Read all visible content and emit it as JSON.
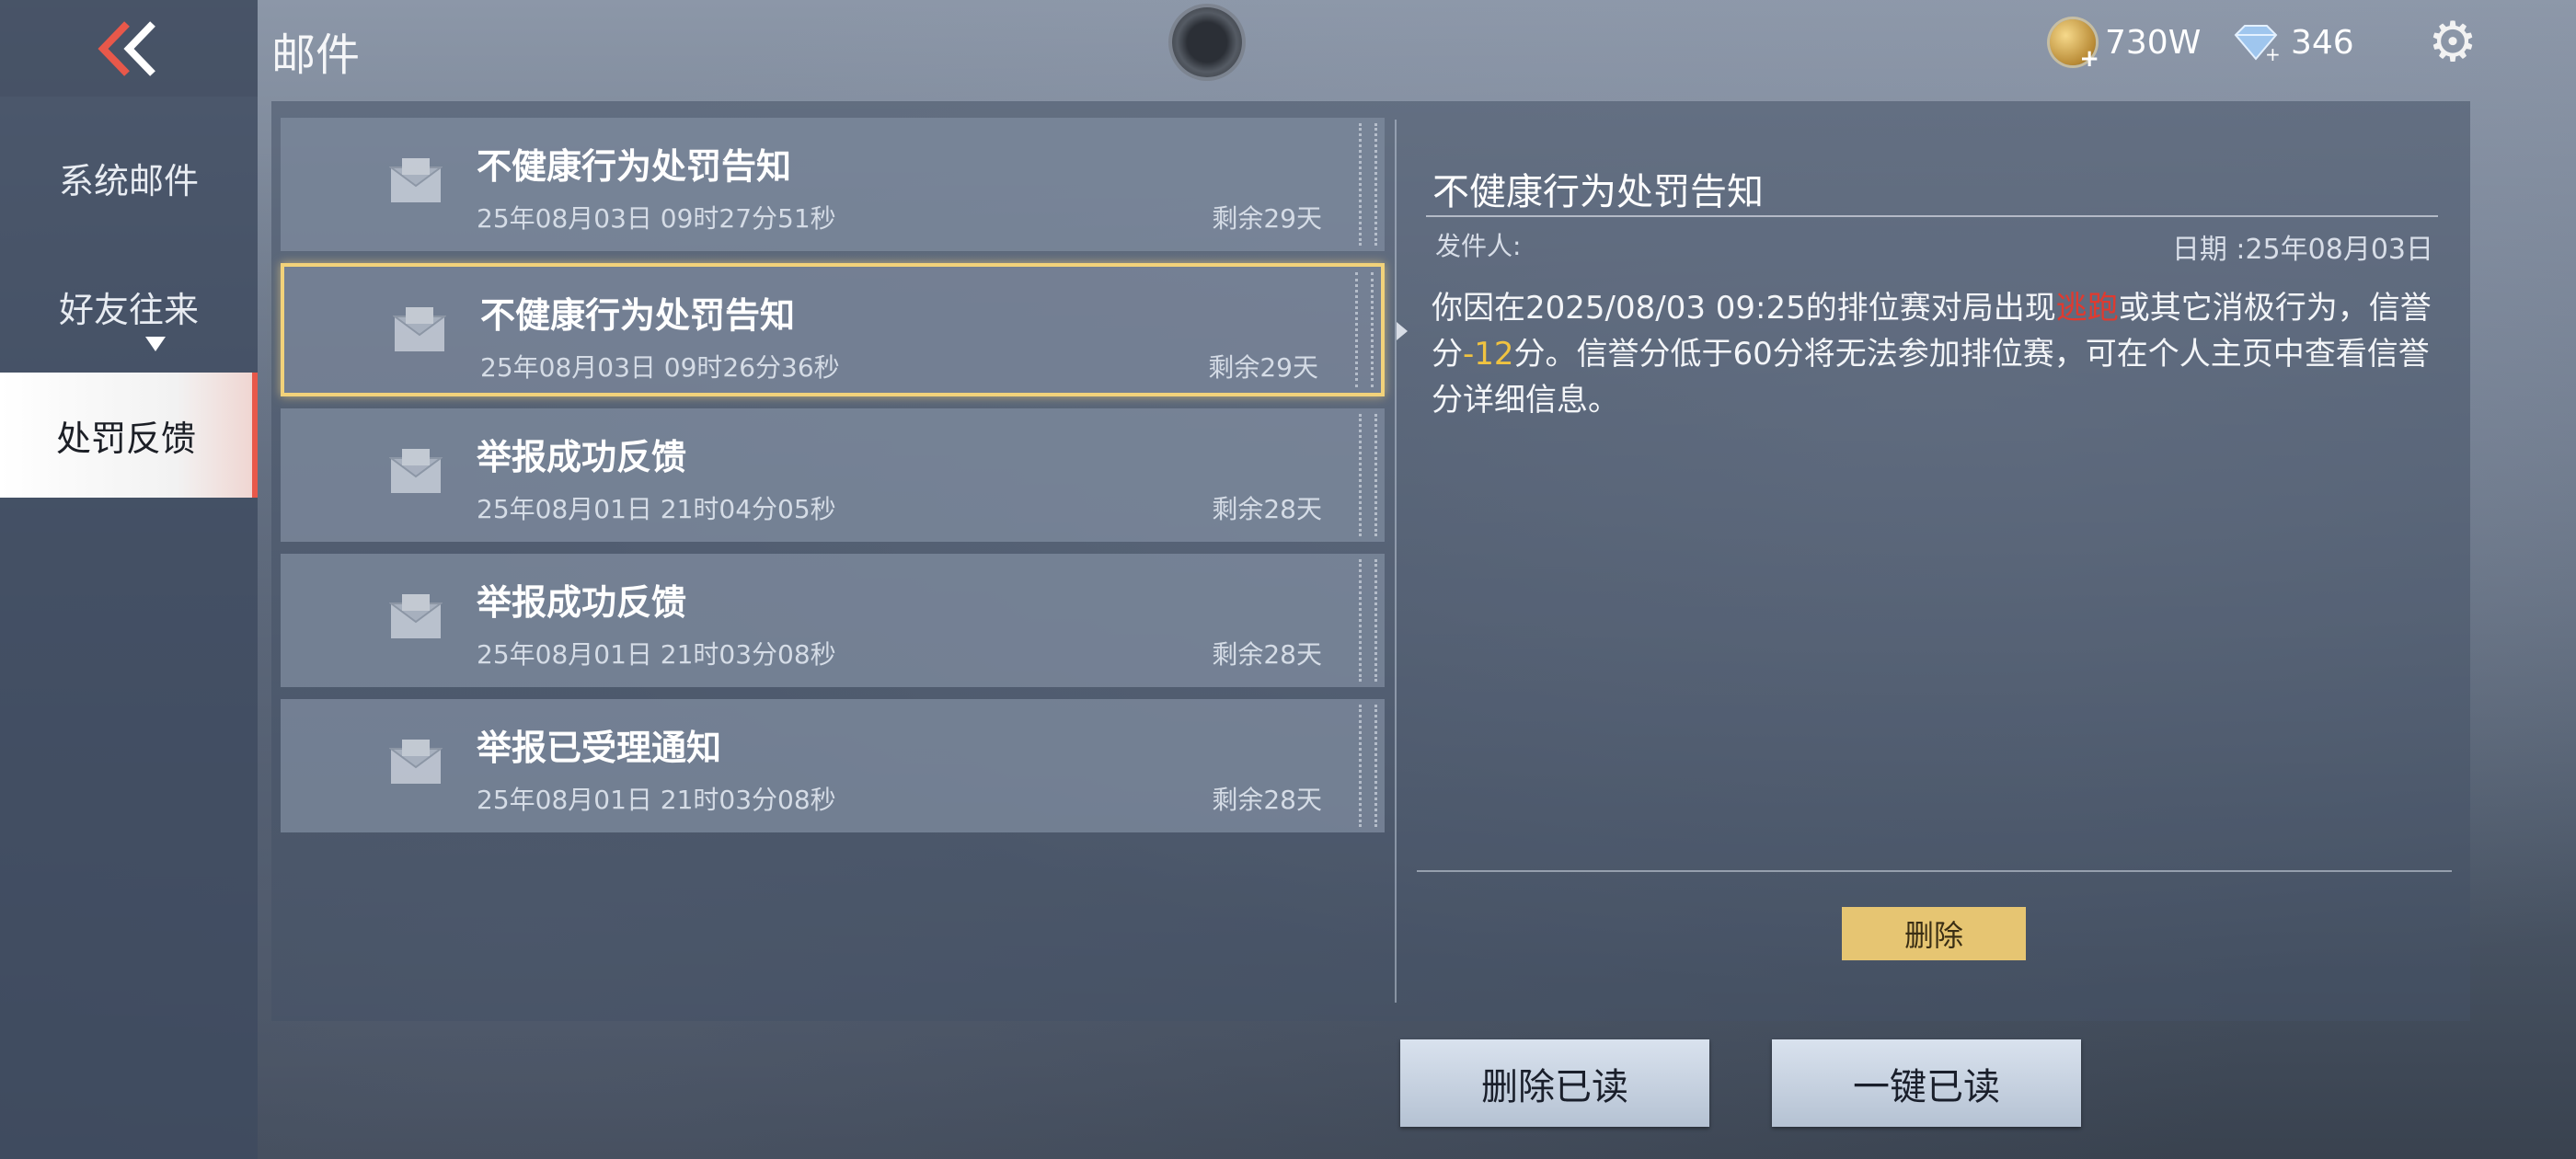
{
  "header": {
    "title": "邮件",
    "gold": "730W",
    "diamonds": "346"
  },
  "sidebar": {
    "items": [
      {
        "label": "系统邮件"
      },
      {
        "label": "好友往来"
      },
      {
        "label": "处罚反馈"
      }
    ]
  },
  "mails": [
    {
      "title": "不健康行为处罚告知",
      "date": "25年08月03日 09时27分51秒",
      "remain": "剩余29天"
    },
    {
      "title": "不健康行为处罚告知",
      "date": "25年08月03日 09时26分36秒",
      "remain": "剩余29天"
    },
    {
      "title": "举报成功反馈",
      "date": "25年08月01日 21时04分05秒",
      "remain": "剩余28天"
    },
    {
      "title": "举报成功反馈",
      "date": "25年08月01日 21时03分08秒",
      "remain": "剩余28天"
    },
    {
      "title": "举报已受理通知",
      "date": "25年08月01日 21时03分08秒",
      "remain": "剩余28天"
    }
  ],
  "detail": {
    "title": "不健康行为处罚告知",
    "sender_label": "发件人:",
    "date": "日期 :25年08月03日",
    "body_1": "你因在2025/08/03 09:25的排位赛对局出现",
    "body_red": "逃跑",
    "body_2": "或其它消极行为，信誉分",
    "body_yellow": "-12",
    "body_3": "分。信誉分低于60分将无法参加排位赛，可在个人主页中查看信誉分详细信息。",
    "delete_label": "删除"
  },
  "footer": {
    "delete_read": "删除已读",
    "mark_all_read": "一键已读"
  },
  "colors": {
    "accent_gold": "#e6c572",
    "selected_border": "#f2d27a",
    "active_tab_marker": "#e8584a",
    "highlight_red": "#e03a2f",
    "highlight_yellow": "#f0c340"
  },
  "selected_mail_index": 1,
  "active_sidebar_index": 2
}
